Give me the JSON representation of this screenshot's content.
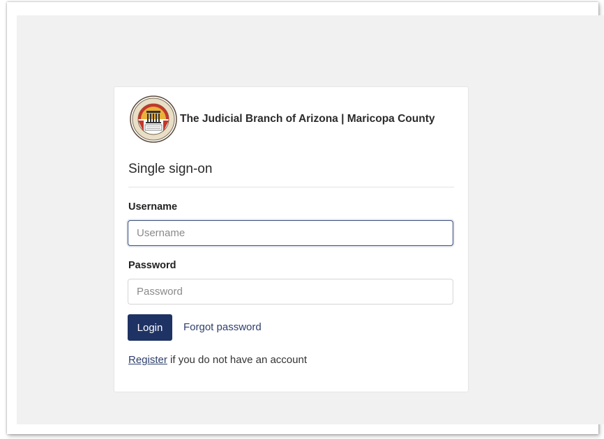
{
  "brand": {
    "title": "The Judicial Branch of Arizona | Maricopa County",
    "seal_icon": "court-seal-icon"
  },
  "form": {
    "heading": "Single sign-on",
    "username_label": "Username",
    "username_placeholder": "Username",
    "username_value": "",
    "password_label": "Password",
    "password_placeholder": "Password",
    "password_value": "",
    "login_label": "Login",
    "forgot_label": "Forgot password",
    "register_link": "Register",
    "register_suffix": " if you do not have an account"
  },
  "colors": {
    "primary": "#1f3264",
    "link": "#2e3f6e",
    "page_background": "#f1f1f1"
  }
}
